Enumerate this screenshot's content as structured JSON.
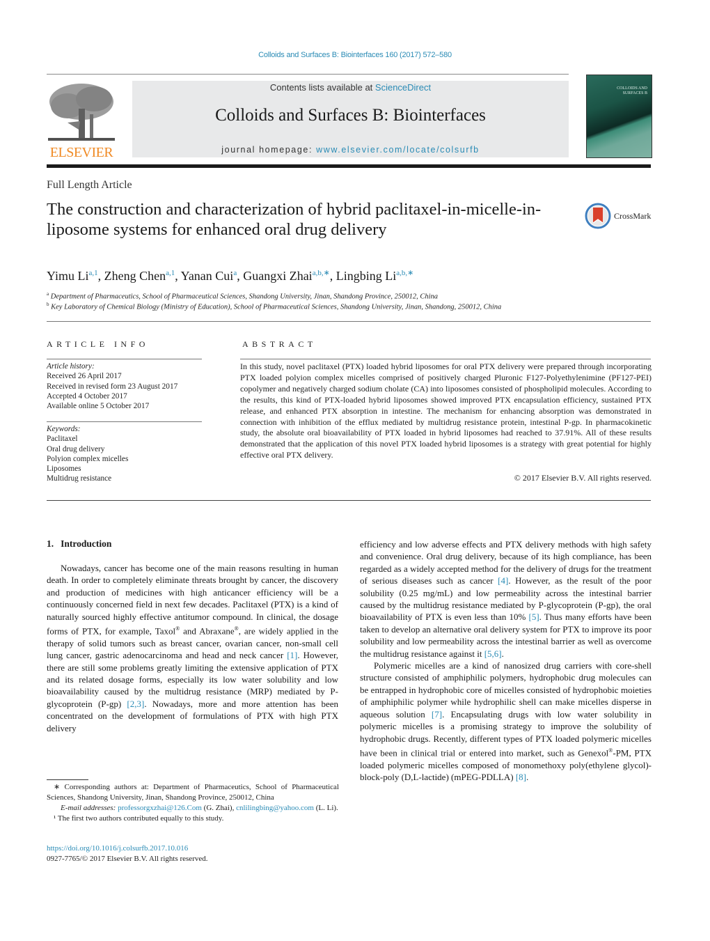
{
  "running_header": "Colloids and Surfaces B: Biointerfaces 160 (2017) 572–580",
  "masthead": {
    "publisher_logo_text": "ELSEVIER",
    "contents_prefix": "Contents lists available at ",
    "contents_link": "ScienceDirect",
    "journal_title": "Colloids and Surfaces B: Biointerfaces",
    "homepage_prefix": "journal homepage: ",
    "homepage_link": "www.elsevier.com/locate/colsurfb",
    "cover_title_line1": "COLLOIDS AND",
    "cover_title_line2": "SURFACES B"
  },
  "article": {
    "type": "Full Length Article",
    "title": "The construction and characterization of hybrid paclitaxel-in-micelle-in-liposome systems for enhanced oral drug delivery",
    "crossmark_label": "CrossMark",
    "authors": [
      {
        "name": "Yimu Li",
        "sup": "a,1"
      },
      {
        "name": "Zheng Chen",
        "sup": "a,1"
      },
      {
        "name": "Yanan Cui",
        "sup": "a"
      },
      {
        "name": "Guangxi Zhai",
        "sup": "a,b,∗"
      },
      {
        "name": "Lingbing Li",
        "sup": "a,b,∗"
      }
    ],
    "affiliations": [
      {
        "mark": "a",
        "text": "Department of Pharmaceutics, School of Pharmaceutical Sciences, Shandong University, Jinan, Shandong Province, 250012, China"
      },
      {
        "mark": "b",
        "text": "Key Laboratory of Chemical Biology (Ministry of Education), School of Pharmaceutical Sciences, Shandong University, Jinan, Shandong, 250012, China"
      }
    ]
  },
  "article_info": {
    "heading": "ARTICLE INFO",
    "history_label": "Article history:",
    "history": [
      "Received 26 April 2017",
      "Received in revised form 23 August 2017",
      "Accepted 4 October 2017",
      "Available online 5 October 2017"
    ],
    "keywords_label": "Keywords:",
    "keywords": [
      "Paclitaxel",
      "Oral drug delivery",
      "Polyion complex micelles",
      "Liposomes",
      "Multidrug resistance"
    ]
  },
  "abstract": {
    "heading": "ABSTRACT",
    "text": "In this study, novel paclitaxel (PTX) loaded hybrid liposomes for oral PTX delivery were prepared through incorporating PTX loaded polyion complex micelles comprised of positively charged Pluronic F127-Polyethylenimine (PF127-PEI) copolymer and negatively charged sodium cholate (CA) into liposomes consisted of phospholipid molecules. According to the results, this kind of PTX-loaded hybrid liposomes showed improved PTX encapsulation efficiency, sustained PTX release, and enhanced PTX absorption in intestine. The mechanism for enhancing absorption was demonstrated in connection with inhibition of the efflux mediated by multidrug resistance protein, intestinal P-gp. In pharmacokinetic study, the absolute oral bioavailability of PTX loaded in hybrid liposomes had reached to 37.91%. All of these results demonstrated that the application of this novel PTX loaded hybrid liposomes is a strategy with great potential for highly effective oral PTX delivery.",
    "copyright": "© 2017 Elsevier B.V. All rights reserved."
  },
  "introduction": {
    "number": "1.",
    "heading": "Introduction",
    "p1_a": "Nowadays, cancer has become one of the main reasons resulting in human death. In order to completely eliminate threats brought by cancer, the discovery and production of medicines with high anticancer efficiency will be a continuously concerned field in next few decades. Paclitaxel (PTX) is a kind of naturally sourced highly effective antitumor compound. In clinical, the dosage forms of PTX, for example, Taxol",
    "p1_b": " and Abraxane",
    "p1_c": ", are widely applied in the therapy of solid tumors such as breast cancer, ovarian cancer, non-small cell lung cancer, gastric adenocarcinoma and head and neck cancer ",
    "ref1": "[1]",
    "p1_d": ". However, there are still some problems greatly limiting the extensive application of PTX and its related dosage forms, especially its low water solubility and low bioavailability caused by the multidrug resistance (MRP) mediated by P-glycoprotein (P-gp) ",
    "ref2": "[2,3]",
    "p1_e": ". Nowadays, more and more attention has been concentrated on the development of formulations of PTX with high PTX delivery efficiency and low adverse effects and PTX delivery methods with high safety and convenience. Oral drug delivery, because of its high compliance, has been regarded as a widely accepted method for the delivery of drugs for the treatment of serious diseases such as cancer ",
    "ref3": "[4]",
    "p1_f": ". However, as the result of the poor solubility (0.25 mg/mL) and low permeability across the intestinal barrier caused by the multidrug resistance mediated by P-glycoprotein (P-gp), the oral bioavailability of PTX is even less than 10% ",
    "ref4": "[5]",
    "p1_g": ". Thus many efforts have been taken to develop an alternative oral delivery system for PTX to improve its poor solubility and low permeability across the intestinal barrier as well as overcome the multidrug resistance against it ",
    "ref5": "[5,6]",
    "p1_h": ".",
    "p2_a": "Polymeric micelles are a kind of nanosized drug carriers with core-shell structure consisted of amphiphilic polymers, hydrophobic drug molecules can be entrapped in hydrophobic core of micelles consisted of hydrophobic moieties of amphiphilic polymer while hydrophilic shell can make micelles disperse in aqueous solution ",
    "ref6": "[7]",
    "p2_b": ". Encapsulating drugs with low water solubility in polymeric micelles is a promising strategy to improve the solubility of hydrophobic drugs. Recently, different types of PTX loaded polymeric micelles have been in clinical trial or entered into market, such as Genexol",
    "p2_c": "-PM, PTX loaded polymeric micelles composed of monomethoxy poly(ethylene glycol)-block-poly (D,L-lactide) (mPEG-PDLLA) ",
    "ref7": "[8]",
    "p2_d": ".",
    "reg_mark": "®"
  },
  "footnotes": {
    "corresponding": "∗ Corresponding authors at: Department of Pharmaceutics, School of Pharmaceutical Sciences, Shandong University, Jinan, Shandong Province, 250012, China",
    "email_label": "E-mail addresses: ",
    "email1": "professorgxzhai@126.Com",
    "email1_owner": " (G. Zhai), ",
    "email2": "cnlilingbing@yahoo.com",
    "email2_owner": " (L. Li).",
    "equal_contrib": "¹ The first two authors contributed equally to this study.",
    "doi": "https://doi.org/10.1016/j.colsurfb.2017.10.016",
    "issn_copyright": "0927-7765/© 2017 Elsevier B.V. All rights reserved."
  }
}
